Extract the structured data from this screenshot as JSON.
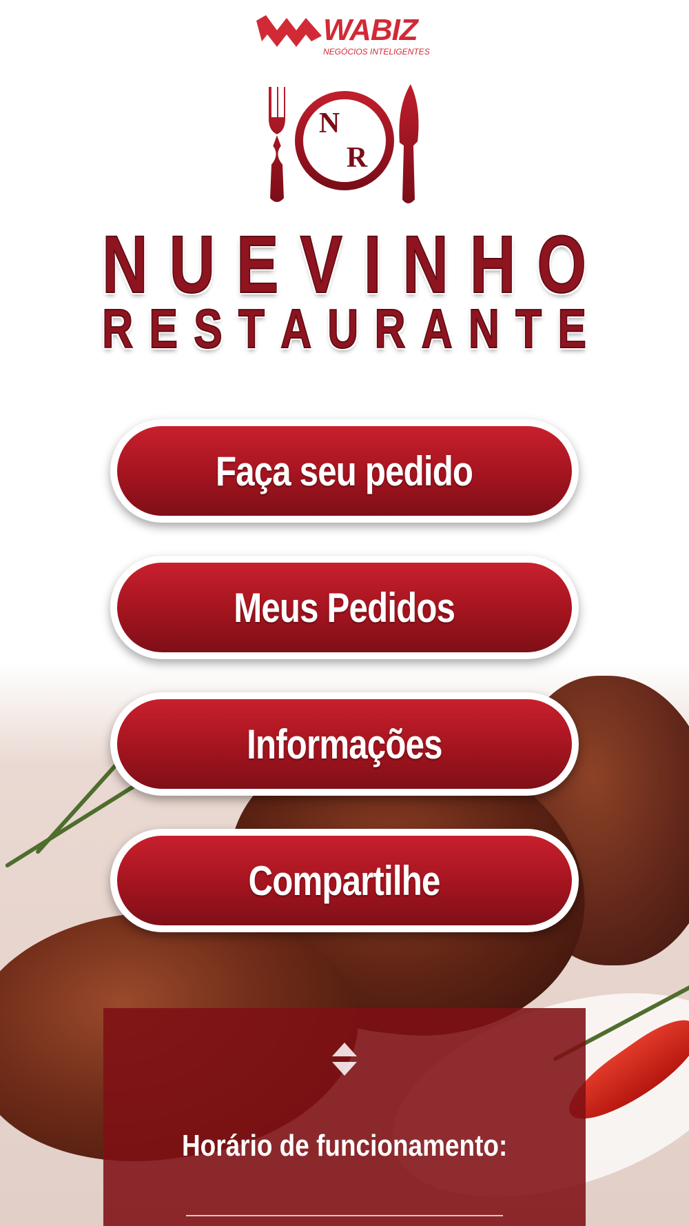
{
  "brand": {
    "name": "WABIZ",
    "tagline": "NEGÓCIOS INTELIGENTES",
    "color": "#d12a36"
  },
  "restaurant": {
    "emblem_letters": "NR",
    "name_line1": "NUEVINHO",
    "name_line2": "RESTAURANTE",
    "color": "#8e1420"
  },
  "menu": {
    "order_label": "Faça seu pedido",
    "my_orders_label": "Meus Pedidos",
    "info_label": "Informações",
    "share_label": "Compartilhe",
    "button_color": "#b01824"
  },
  "hours": {
    "title": "Horário de funcionamento:",
    "toggle_icon": "sort-updown-icon",
    "panel_color": "#7e1014"
  }
}
